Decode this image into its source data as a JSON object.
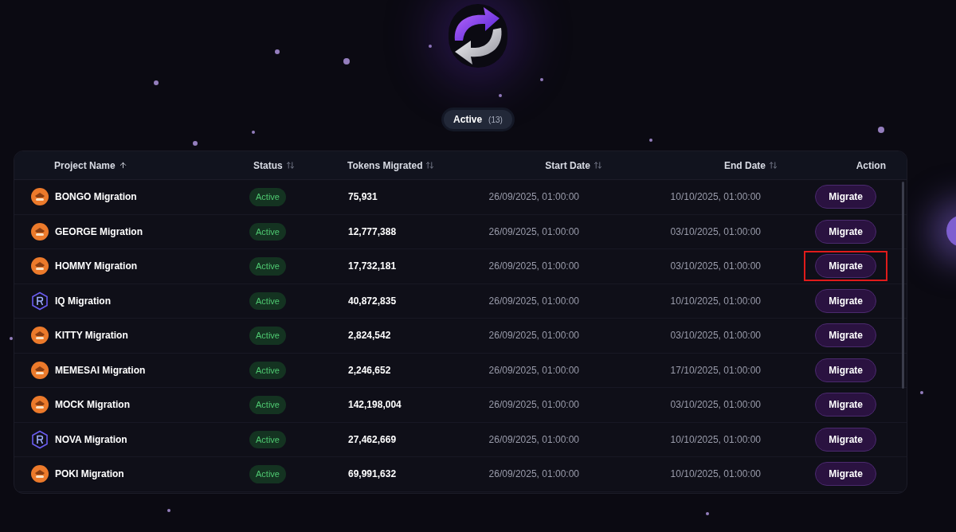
{
  "filter_tab": {
    "label": "Active",
    "count": "(13)",
    "selected": true
  },
  "table": {
    "columns": [
      {
        "label": "Project Name",
        "sortable": true,
        "sorted": true
      },
      {
        "label": "Status",
        "sortable": true,
        "sorted": false
      },
      {
        "label": "Tokens Migrated",
        "sortable": true,
        "sorted": false
      },
      {
        "label": "Start Date",
        "sortable": true,
        "sorted": false
      },
      {
        "label": "End Date",
        "sortable": true,
        "sorted": false
      },
      {
        "label": "Action",
        "sortable": false,
        "sorted": false
      }
    ],
    "rows": [
      {
        "kind": "token",
        "name": "BONGO Migration",
        "status": "Active",
        "tokens": "75,931",
        "start": "26/09/2025, 01:00:00",
        "end": "10/10/2025, 01:00:00",
        "action": "Migrate",
        "highlighted": false
      },
      {
        "kind": "token",
        "name": "GEORGE Migration",
        "status": "Active",
        "tokens": "12,777,388",
        "start": "26/09/2025, 01:00:00",
        "end": "03/10/2025, 01:00:00",
        "action": "Migrate",
        "highlighted": false
      },
      {
        "kind": "token",
        "name": "HOMMY Migration",
        "status": "Active",
        "tokens": "17,732,181",
        "start": "26/09/2025, 01:00:00",
        "end": "03/10/2025, 01:00:00",
        "action": "Migrate",
        "highlighted": true
      },
      {
        "kind": "hex",
        "name": "IQ Migration",
        "status": "Active",
        "tokens": "40,872,835",
        "start": "26/09/2025, 01:00:00",
        "end": "10/10/2025, 01:00:00",
        "action": "Migrate",
        "highlighted": false
      },
      {
        "kind": "token",
        "name": "KITTY Migration",
        "status": "Active",
        "tokens": "2,824,542",
        "start": "26/09/2025, 01:00:00",
        "end": "03/10/2025, 01:00:00",
        "action": "Migrate",
        "highlighted": false
      },
      {
        "kind": "token",
        "name": "MEMESAI Migration",
        "status": "Active",
        "tokens": "2,246,652",
        "start": "26/09/2025, 01:00:00",
        "end": "17/10/2025, 01:00:00",
        "action": "Migrate",
        "highlighted": false
      },
      {
        "kind": "token",
        "name": "MOCK Migration",
        "status": "Active",
        "tokens": "142,198,004",
        "start": "26/09/2025, 01:00:00",
        "end": "03/10/2025, 01:00:00",
        "action": "Migrate",
        "highlighted": false
      },
      {
        "kind": "hex",
        "name": "NOVA Migration",
        "status": "Active",
        "tokens": "27,462,669",
        "start": "26/09/2025, 01:00:00",
        "end": "10/10/2025, 01:00:00",
        "action": "Migrate",
        "highlighted": false
      },
      {
        "kind": "token",
        "name": "POKI Migration",
        "status": "Active",
        "tokens": "69,991,632",
        "start": "26/09/2025, 01:00:00",
        "end": "10/10/2025, 01:00:00",
        "action": "Migrate",
        "highlighted": false
      }
    ]
  }
}
